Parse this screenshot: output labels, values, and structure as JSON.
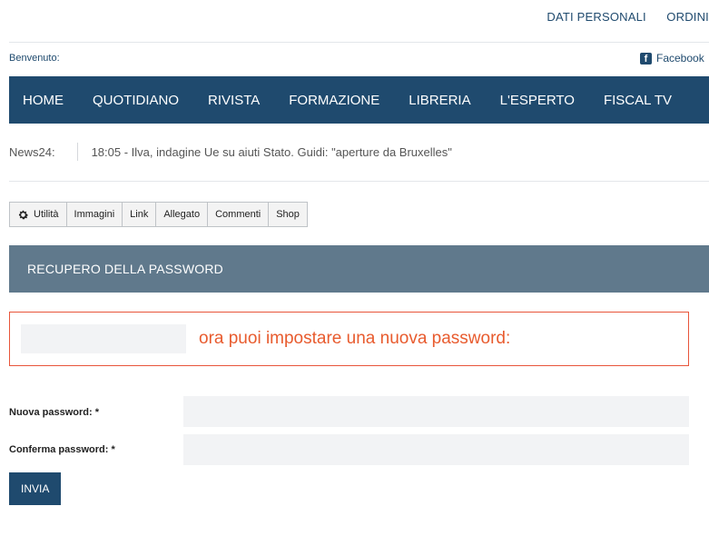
{
  "top_links": [
    "DATI PERSONALI",
    "ORDINI"
  ],
  "welcome_label": "Benvenuto:",
  "social": {
    "facebook_label": "Facebook",
    "icon": "facebook-icon"
  },
  "nav": [
    "HOME",
    "QUOTIDIANO",
    "RIVISTA",
    "FORMAZIONE",
    "LIBRERIA",
    "L'ESPERTO",
    "FISCAL TV"
  ],
  "news": {
    "label": "News24:",
    "headline": "18:05 - Ilva, indagine Ue su aiuti Stato. Guidi: \"aperture da Bruxelles\""
  },
  "toolbar": {
    "items": [
      "Utilità",
      "Immagini",
      "Link",
      "Allegato",
      "Commenti",
      "Shop"
    ],
    "first_icon": "gear-icon"
  },
  "section_title": "RECUPERO DELLA PASSWORD",
  "alert_message": "ora puoi impostare una nuova password:",
  "form": {
    "new_password_label": "Nuova password: *",
    "confirm_password_label": "Conferma password: *",
    "new_password_value": "",
    "confirm_password_value": "",
    "submit_label": "INVIA"
  },
  "colors": {
    "primary": "#1f4a6e",
    "section_header": "#60798c",
    "alert": "#e85b2e"
  }
}
